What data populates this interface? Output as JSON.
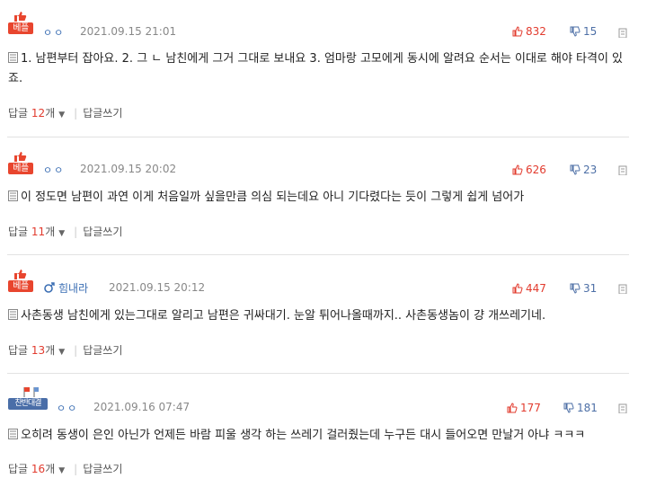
{
  "badge_best": "베플",
  "badge_flag": "찬반대결",
  "reply_label": "답글",
  "count_suffix": "개",
  "write_reply": "답글쓰기",
  "colors": {
    "up": "#e23b2e",
    "down": "#4d6fa6",
    "nick": "#3c6fb4",
    "badge": "#e8452e"
  },
  "comments": [
    {
      "badge": "베플",
      "nick": "ㅇㅇ",
      "datetime": "2021.09.15 21:01",
      "up": "832",
      "down": "15",
      "text": "1. 남편부터 잡아요. 2. 그 ㄴ 남친에게 그거 그대로 보내요 3. 엄마랑 고모에게 동시에 알려요 순서는 이대로 해야 타격이 있죠.",
      "reply_count": "12"
    },
    {
      "badge": "베플",
      "nick": "ㅇㅇ",
      "datetime": "2021.09.15 20:02",
      "up": "626",
      "down": "23",
      "text": "이 정도면 남편이 과연 이게 처음일까 싶을만큼 의심 되는데요 아니 기다렸다는 듯이 그렇게 쉽게 넘어가",
      "reply_count": "11"
    },
    {
      "badge": "베플",
      "nick": "힘내라",
      "datetime": "2021.09.15 20:12",
      "up": "447",
      "down": "31",
      "text": "사촌동생 남친에게 있는그대로 알리고 남편은 귀싸대기. 눈알 튀어나올때까지.. 사촌동생놈이 걍 개쓰레기네.",
      "reply_count": "13"
    },
    {
      "badge": "찬반대결",
      "nick": "ㅇㅇ",
      "datetime": "2021.09.16 07:47",
      "up": "177",
      "down": "181",
      "text": "오히려 동생이 은인 아닌가 언제든 바람 피울 생각 하는 쓰레기 걸러줬는데 누구든 대시 들어오면 만날거 아냐 ㅋㅋㅋ",
      "reply_count": "16"
    }
  ]
}
